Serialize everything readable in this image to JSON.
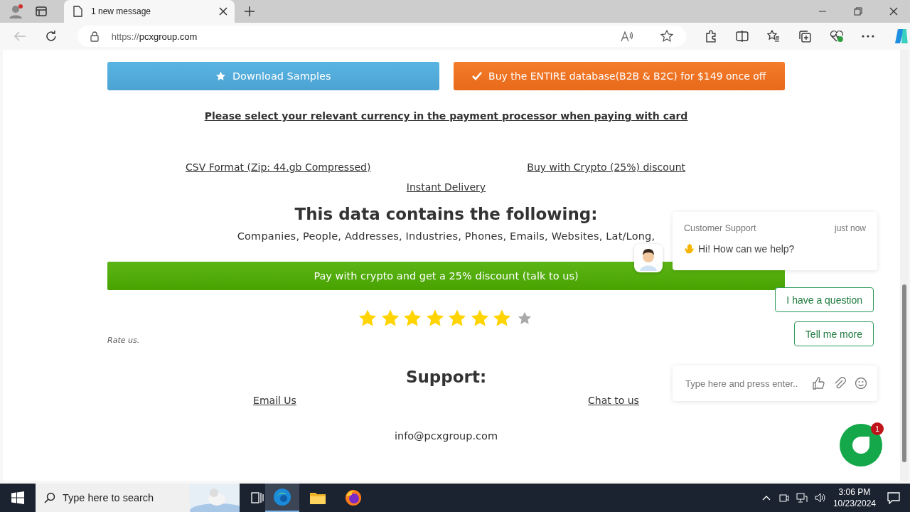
{
  "browser": {
    "tab_title": "1 new message",
    "url_scheme": "https://",
    "url_host": "pcxgroup.com"
  },
  "page": {
    "download_button": "Download Samples",
    "buy_button": "Buy the ENTIRE database(B2B & B2C) for $149 once off",
    "currency_note": "Please select your relevant currency in the payment processor when paying with card",
    "links": [
      "CSV Format (Zip: 44.gb Compressed)",
      "Buy with Crypto (25%) discount"
    ],
    "delivery_link": "Instant Delivery",
    "heading": "This data contains the following:",
    "features": "Companies, People, Addresses, Industries, Phones, Emails, Websites, Lat/Long,",
    "crypto_bar": "Pay with crypto and get a 25% discount (talk to us)",
    "stars": 7,
    "rate_label": "Rate us.",
    "support_heading": "Support:",
    "support_links": [
      "Email Us",
      "Chat to us"
    ],
    "email": "info@pcxgroup.com"
  },
  "chat": {
    "sender": "Customer Support",
    "time": "just now",
    "message": "Hi! How can we help?",
    "quick_replies": [
      "I have a question",
      "Tell me more"
    ],
    "placeholder": "Type here and press enter..",
    "badge": "1"
  },
  "taskbar": {
    "search_placeholder": "Type here to search",
    "time": "3:06 PM",
    "date": "10/23/2024"
  }
}
